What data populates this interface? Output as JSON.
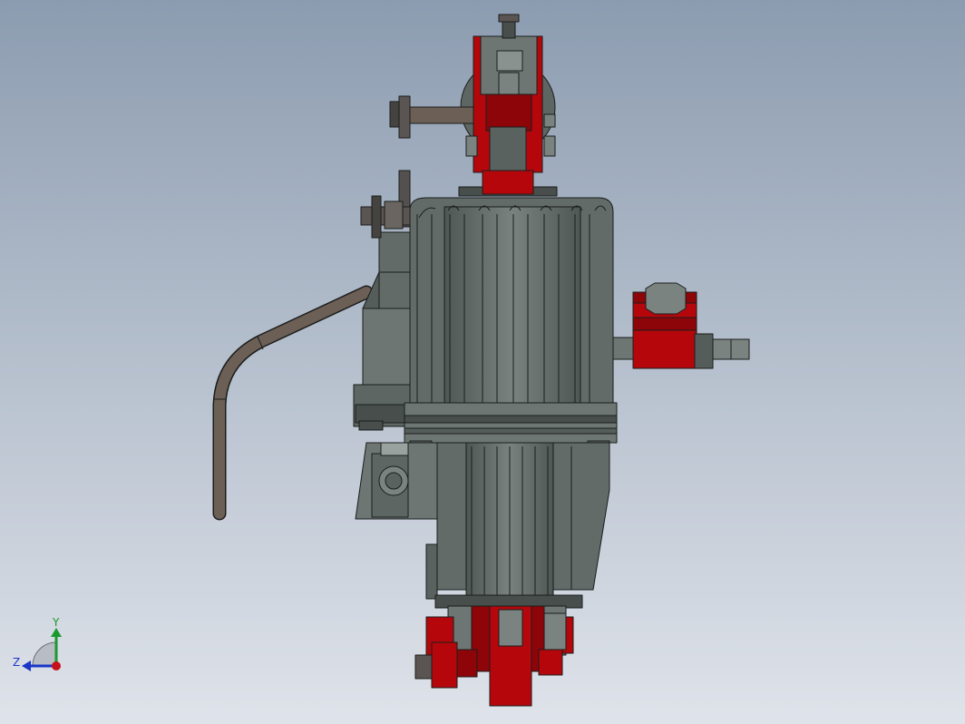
{
  "viewport": {
    "background_top": "#8c9cb0",
    "background_bottom": "#dfe3ea"
  },
  "colors": {
    "body": "#636b68",
    "body_light": "#7a8380",
    "body_dark": "#474e4c",
    "outline": "#1a1d1c",
    "red": "#b5070b",
    "red_dark": "#7a0508",
    "pipe": "#6c5f55",
    "bolt": "#45433f"
  },
  "triad": {
    "y_label": "Y",
    "z_label": "Z",
    "y_color": "#1a9a2c",
    "z_color": "#1a36c8",
    "x_color": "#c8101a"
  }
}
